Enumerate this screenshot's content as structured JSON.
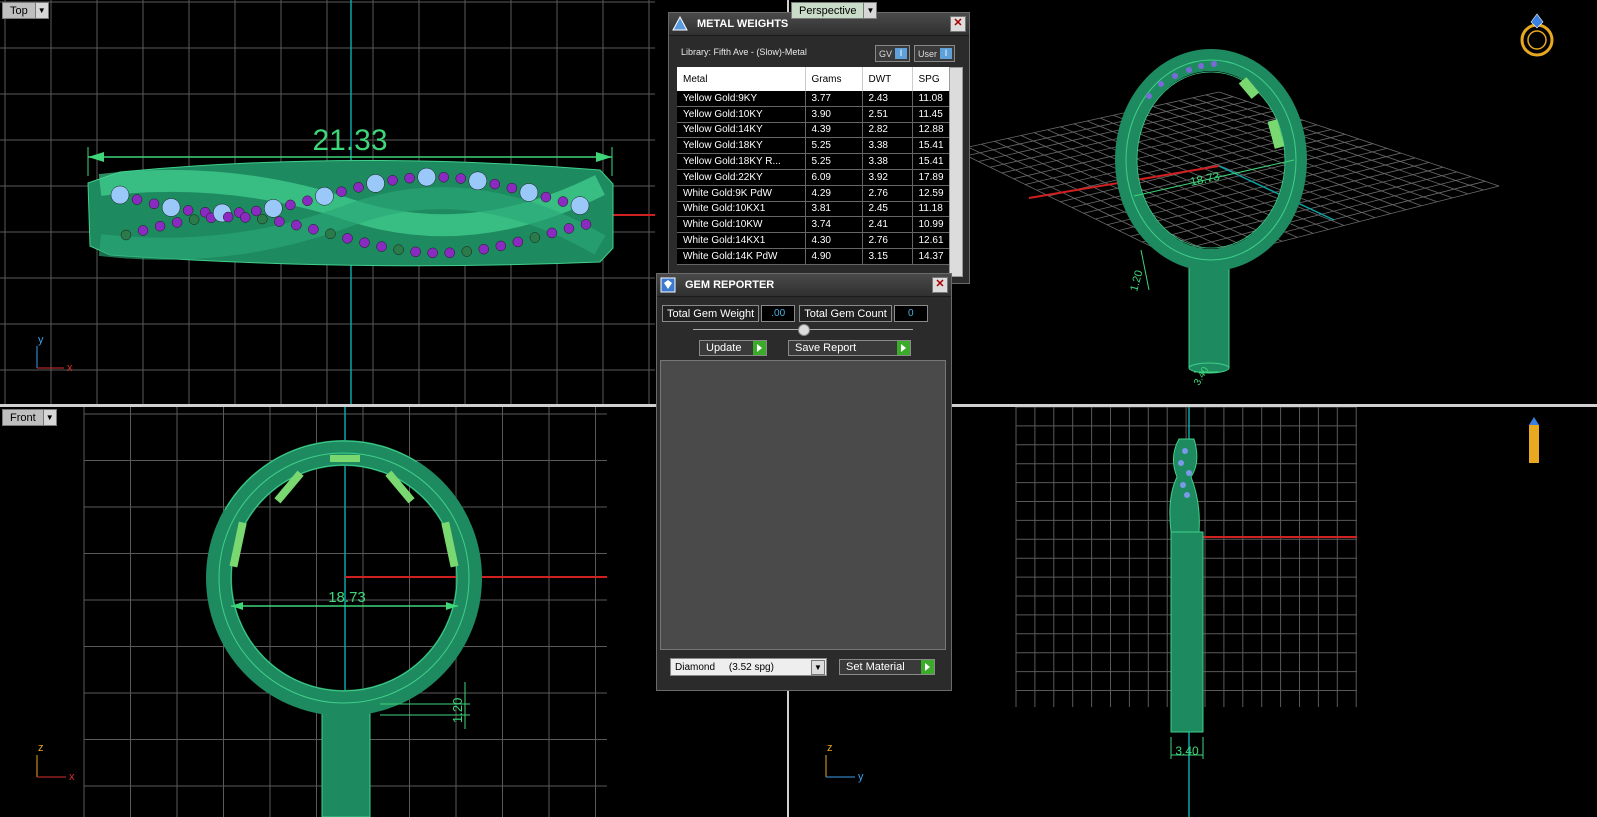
{
  "viewports": {
    "top": {
      "label": "Top",
      "dimension": "21.33",
      "axis_v": "y",
      "axis_h": "x"
    },
    "perspective": {
      "label": "Perspective",
      "dim_main": "18.73",
      "dim_side": "1.20",
      "dim_base": "3.40"
    },
    "front": {
      "label": "Front",
      "dimension": "18.73",
      "dim_side": "1.20",
      "axis_v": "z",
      "axis_h": "x"
    },
    "right": {
      "dim_base": "3.40",
      "axis_v": "z",
      "axis_h": "y"
    }
  },
  "metal_weights": {
    "title": "METAL WEIGHTS",
    "library": "Library: Fifth Ave - (Slow)-Metal",
    "toggle_gv": "GV",
    "toggle_user": "User",
    "columns": [
      "Metal",
      "Grams",
      "DWT",
      "SPG"
    ],
    "rows": [
      [
        "Yellow Gold:9KY",
        "3.77",
        "2.43",
        "11.08"
      ],
      [
        "Yellow Gold:10KY",
        "3.90",
        "2.51",
        "11.45"
      ],
      [
        "Yellow Gold:14KY",
        "4.39",
        "2.82",
        "12.88"
      ],
      [
        "Yellow Gold:18KY",
        "5.25",
        "3.38",
        "15.41"
      ],
      [
        "Yellow Gold:18KY R...",
        "5.25",
        "3.38",
        "15.41"
      ],
      [
        "Yellow Gold:22KY",
        "6.09",
        "3.92",
        "17.89"
      ],
      [
        "White Gold:9K PdW",
        "4.29",
        "2.76",
        "12.59"
      ],
      [
        "White Gold:10KX1",
        "3.81",
        "2.45",
        "11.18"
      ],
      [
        "White Gold:10KW",
        "3.74",
        "2.41",
        "10.99"
      ],
      [
        "White Gold:14KX1",
        "4.30",
        "2.76",
        "12.61"
      ],
      [
        "White Gold:14K PdW",
        "4.90",
        "3.15",
        "14.37"
      ]
    ]
  },
  "gem_reporter": {
    "title": "GEM REPORTER",
    "total_weight_label": "Total Gem Weight",
    "total_weight_value": ".00",
    "total_count_label": "Total Gem Count",
    "total_count_value": "0",
    "update_label": "Update",
    "save_label": "Save Report",
    "material_value": "Diamond     (3.52 spg)",
    "set_material_label": "Set Material"
  }
}
